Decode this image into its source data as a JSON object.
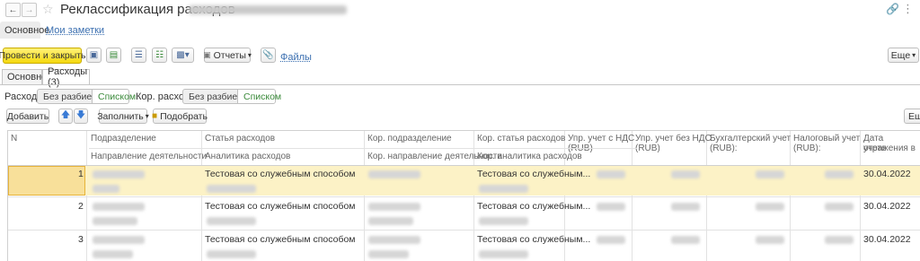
{
  "window": {
    "title": "Реклассификация расходов",
    "link_icon": "link-icon",
    "menu_icon": "more-vertical-icon"
  },
  "form_tabs": [
    {
      "label": "Основное",
      "active": true
    },
    {
      "label": "Мои заметки",
      "active": false
    }
  ],
  "toolbar": {
    "post_close": "Провести и закрыть",
    "reports": "Отчеты",
    "files": "Файлы",
    "more": "Еще"
  },
  "doc_tabs": [
    {
      "label": "Основное",
      "active": false
    },
    {
      "label": "Расходы (3)",
      "active": true
    }
  ],
  "filters": {
    "expenses_label": "Расходы:",
    "kor_expenses_label": "Кор. расходы:",
    "no_split": "Без разбиения",
    "list": "Списком"
  },
  "table_toolbar": {
    "add": "Добавить",
    "fill": "Заполнить",
    "pick": "Подобрать",
    "more": "Ещ"
  },
  "table": {
    "headers": {
      "n": "N",
      "dept": "Подразделение",
      "direction": "Направление деятельности",
      "expense_item": "Статья расходов",
      "expense_analytics": "Аналитика расходов",
      "kor_dept": "Кор. подразделение",
      "kor_direction": "Кор. направление деятельности",
      "kor_expense_item": "Кор. статья расходов",
      "kor_analytics": "Кор. аналитика расходов",
      "mgmt_vat_1": "Упр. учет с НДС",
      "mgmt_vat_2": "(RUB)",
      "mgmt_novat_1": "Упр. учет без НДС",
      "mgmt_novat_2": "(RUB)",
      "acc_1": "Бухгалтерский учет",
      "acc_2": "(RUB):",
      "tax_1": "Налоговый учет",
      "tax_2": "(RUB):",
      "date_1": "Дата отражения в",
      "date_2": "учете"
    },
    "rows": [
      {
        "n": "1",
        "expense_item": "Тестовая со служебным способом",
        "kor_expense_item": "Тестовая со служебным...",
        "date": "30.04.2022"
      },
      {
        "n": "2",
        "expense_item": "Тестовая со служебным способом",
        "kor_expense_item": "Тестовая со служебным...",
        "date": "30.04.2022"
      },
      {
        "n": "3",
        "expense_item": "Тестовая со служебным способом",
        "kor_expense_item": "Тестовая со служебным...",
        "date": "30.04.2022"
      }
    ]
  }
}
